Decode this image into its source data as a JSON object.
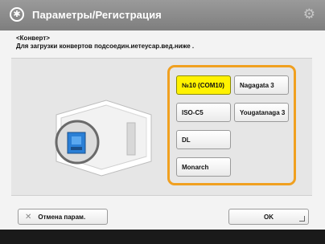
{
  "header": {
    "title": "Параметры/Регистрация",
    "home_icon": "home-icon",
    "settings_icon": "gear-icon"
  },
  "instructions": {
    "line1": "<Конверт>",
    "line2": "Для загрузки конвертов подсоедин.иетеусар.вед.ниже ."
  },
  "envelope_options": [
    {
      "label": "№10 (COM10)",
      "selected": true
    },
    {
      "label": "Nagagata 3",
      "selected": false
    },
    {
      "label": "ISO-C5",
      "selected": false
    },
    {
      "label": "Yougatanaga 3",
      "selected": false
    },
    {
      "label": "DL",
      "selected": false
    },
    {
      "label": "Monarch",
      "selected": false
    }
  ],
  "footer": {
    "cancel_label": "Отмена парам.",
    "ok_label": "OK"
  },
  "colors": {
    "selected": "#fff200",
    "group_border": "#f0a020",
    "header": "#8a8a8a"
  }
}
